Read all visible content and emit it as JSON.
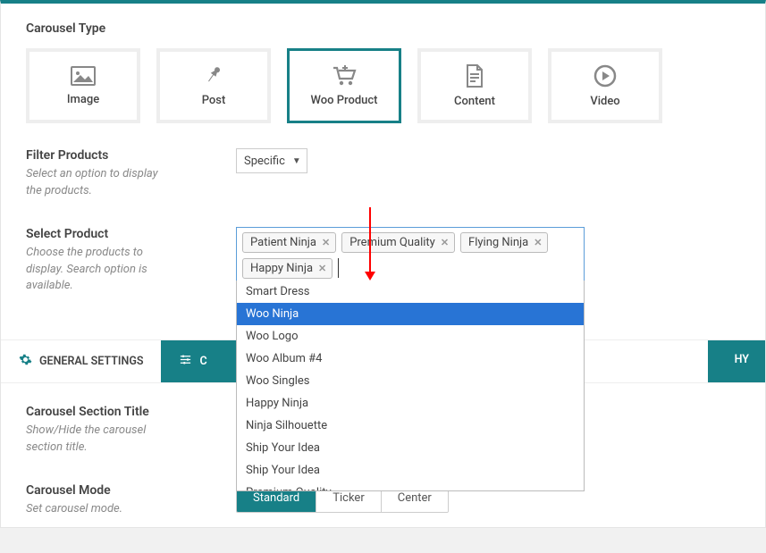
{
  "carousel_type": {
    "heading": "Carousel Type",
    "options": [
      {
        "id": "image",
        "label": "Image",
        "selected": false
      },
      {
        "id": "post",
        "label": "Post",
        "selected": false
      },
      {
        "id": "woo",
        "label": "Woo Product",
        "selected": true
      },
      {
        "id": "content",
        "label": "Content",
        "selected": false
      },
      {
        "id": "video",
        "label": "Video",
        "selected": false
      }
    ]
  },
  "filter_products": {
    "label": "Filter Products",
    "hint": "Select an option to display the products.",
    "value": "Specific"
  },
  "select_product": {
    "label": "Select Product",
    "hint": "Choose the products to display. Search option is available.",
    "tags": [
      "Patient Ninja",
      "Premium Quality",
      "Flying Ninja",
      "Happy Ninja"
    ],
    "options": [
      "Smart Dress",
      "Woo Ninja",
      "Woo Logo",
      "Woo Album #4",
      "Woo Singles",
      "Happy Ninja",
      "Ninja Silhouette",
      "Ship Your Idea",
      "Ship Your Idea",
      "Premium Quality"
    ],
    "highlight_index": 1
  },
  "tabs": {
    "general": "GENERAL SETTINGS",
    "second_prefix": "C",
    "tail_suffix": "HY"
  },
  "carousel_section_title": {
    "label": "Carousel Section Title",
    "hint": "Show/Hide the carousel section title."
  },
  "carousel_mode": {
    "label": "Carousel Mode",
    "hint": "Set carousel mode.",
    "options": [
      "Standard",
      "Ticker",
      "Center"
    ],
    "selected": "Standard"
  },
  "icons": {
    "image": "image-icon",
    "post": "pin-icon",
    "woo": "cart-icon",
    "content": "document-icon",
    "video": "play-icon",
    "gear": "gear-icon",
    "sliders": "sliders-icon"
  }
}
